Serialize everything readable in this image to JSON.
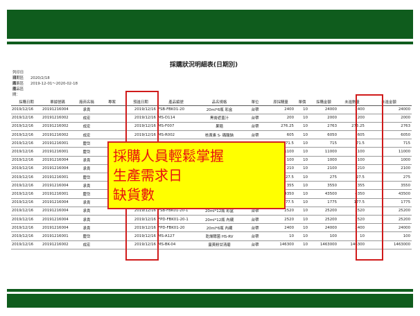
{
  "report": {
    "title": "採購狀況明細表(日期別)",
    "meta": [
      {
        "label": "列印日期：",
        "value": "2020/2/18"
      },
      {
        "label": "日期區間：",
        "value": "2019-12-01～2020-02-18"
      },
      {
        "label": "廠商區間：",
        "value": ""
      },
      {
        "label": "產品區間：",
        "value": ""
      }
    ],
    "columns": [
      "採購日期",
      "單據號碼",
      "廠商名稱",
      "專案",
      "預進日期",
      "產品編號",
      "品名規格",
      "單位",
      "原採購量",
      "單價",
      "採購金額",
      "未進數量",
      "未進金額"
    ],
    "rows": [
      [
        "2019/12/16",
        "20191216004",
        "承貴",
        "",
        "2019/12/16",
        "FSB-FBK01-20",
        "20ml*6瓶 彩盒",
        "台帶",
        "2400",
        "10",
        "24000",
        "2400",
        "24000"
      ],
      [
        "2019/12/16",
        "20191216002",
        "成宏",
        "",
        "2019/12/16",
        "MS-D114",
        "黑膏遮蓋汁",
        "台帶",
        "200",
        "10",
        "2000",
        "200",
        "2000"
      ],
      [
        "2019/12/16",
        "20191216002",
        "成宏",
        "",
        "2019/12/16",
        "MS-F007",
        "果隨",
        "台帶",
        "276.25",
        "10",
        "2763",
        "276.25",
        "2763"
      ],
      [
        "2019/12/16",
        "20191216002",
        "成宏",
        "",
        "2019/12/16",
        "MS-R002",
        "核黃素 S- 碼酸鈉",
        "台帶",
        "605",
        "10",
        "6050",
        "605",
        "6050"
      ],
      [
        "2019/12/16",
        "20191216001",
        "慶岱",
        "",
        "2019/12/16",
        "",
        "",
        "",
        "71.5",
        "10",
        "715",
        "71.5",
        "715"
      ],
      [
        "2019/12/16",
        "20191216001",
        "慶岱",
        "",
        "2019/12/16",
        "",
        "",
        "",
        "1100",
        "10",
        "11000",
        "1100",
        "11000"
      ],
      [
        "2019/12/16",
        "20191216004",
        "承貴",
        "",
        "2019/12/16",
        "",
        "",
        "",
        "100",
        "10",
        "1000",
        "100",
        "1000"
      ],
      [
        "2019/12/16",
        "20191216004",
        "承貴",
        "",
        "2019/12/16",
        "",
        "",
        "",
        "210",
        "10",
        "2100",
        "210",
        "2100"
      ],
      [
        "2019/12/16",
        "20191216001",
        "慶岱",
        "",
        "2019/12/16",
        "",
        "",
        "",
        "27.5",
        "10",
        "275",
        "27.5",
        "275"
      ],
      [
        "2019/12/16",
        "20191216004",
        "承貴",
        "",
        "2019/12/16",
        "",
        "",
        "",
        "355",
        "10",
        "3550",
        "355",
        "3550"
      ],
      [
        "2019/12/16",
        "20191216001",
        "慶岱",
        "",
        "2019/12/16",
        "",
        "",
        "",
        "4350",
        "10",
        "43500",
        "4350",
        "43500"
      ],
      [
        "2019/12/16",
        "20191216004",
        "承貴",
        "",
        "2019/12/16",
        "",
        "",
        "",
        "177.5",
        "10",
        "1775",
        "177.5",
        "1775"
      ],
      [
        "2019/12/16",
        "20191216004",
        "承貴",
        "",
        "2019/12/16",
        "FSB-FBK01-20-1",
        "20ml*12瓶 彩盒",
        "台帶",
        "2520",
        "10",
        "25200",
        "2520",
        "25200"
      ],
      [
        "2019/12/16",
        "20191216004",
        "承貴",
        "",
        "2019/12/16",
        "FPD-FBK01-20-1",
        "20ml*12瓶 內襯",
        "台帶",
        "2520",
        "10",
        "25200",
        "2520",
        "25200"
      ],
      [
        "2019/12/16",
        "20191216004",
        "承貴",
        "",
        "2019/12/16",
        "FPD-FBK01-20",
        "20ml*6瓶 內襯",
        "台帶",
        "2400",
        "10",
        "24000",
        "2400",
        "24000"
      ],
      [
        "2019/12/16",
        "20191216001",
        "慶岱",
        "",
        "2019/12/16",
        "MS-A127",
        "乾燥酵菌 HS-RV",
        "台帶",
        "10",
        "10",
        "100",
        "10",
        "100"
      ],
      [
        "2019/12/16",
        "20191216002",
        "成宏",
        "",
        "2019/12/16",
        "MS-BK-04",
        "薑黃粉甘清磨",
        "台帶",
        "146300",
        "10",
        "1463000",
        "146300",
        "1463000"
      ]
    ]
  },
  "callout": {
    "lines": [
      "採購人員輕鬆掌握",
      "生產需求日",
      "缺貨數"
    ],
    "text_color": "#e81010",
    "background": "#ffff00",
    "border_color": "#d42020"
  },
  "theme": {
    "band_color": "#0f5c1d",
    "highlight_color": "#d01a1a"
  }
}
